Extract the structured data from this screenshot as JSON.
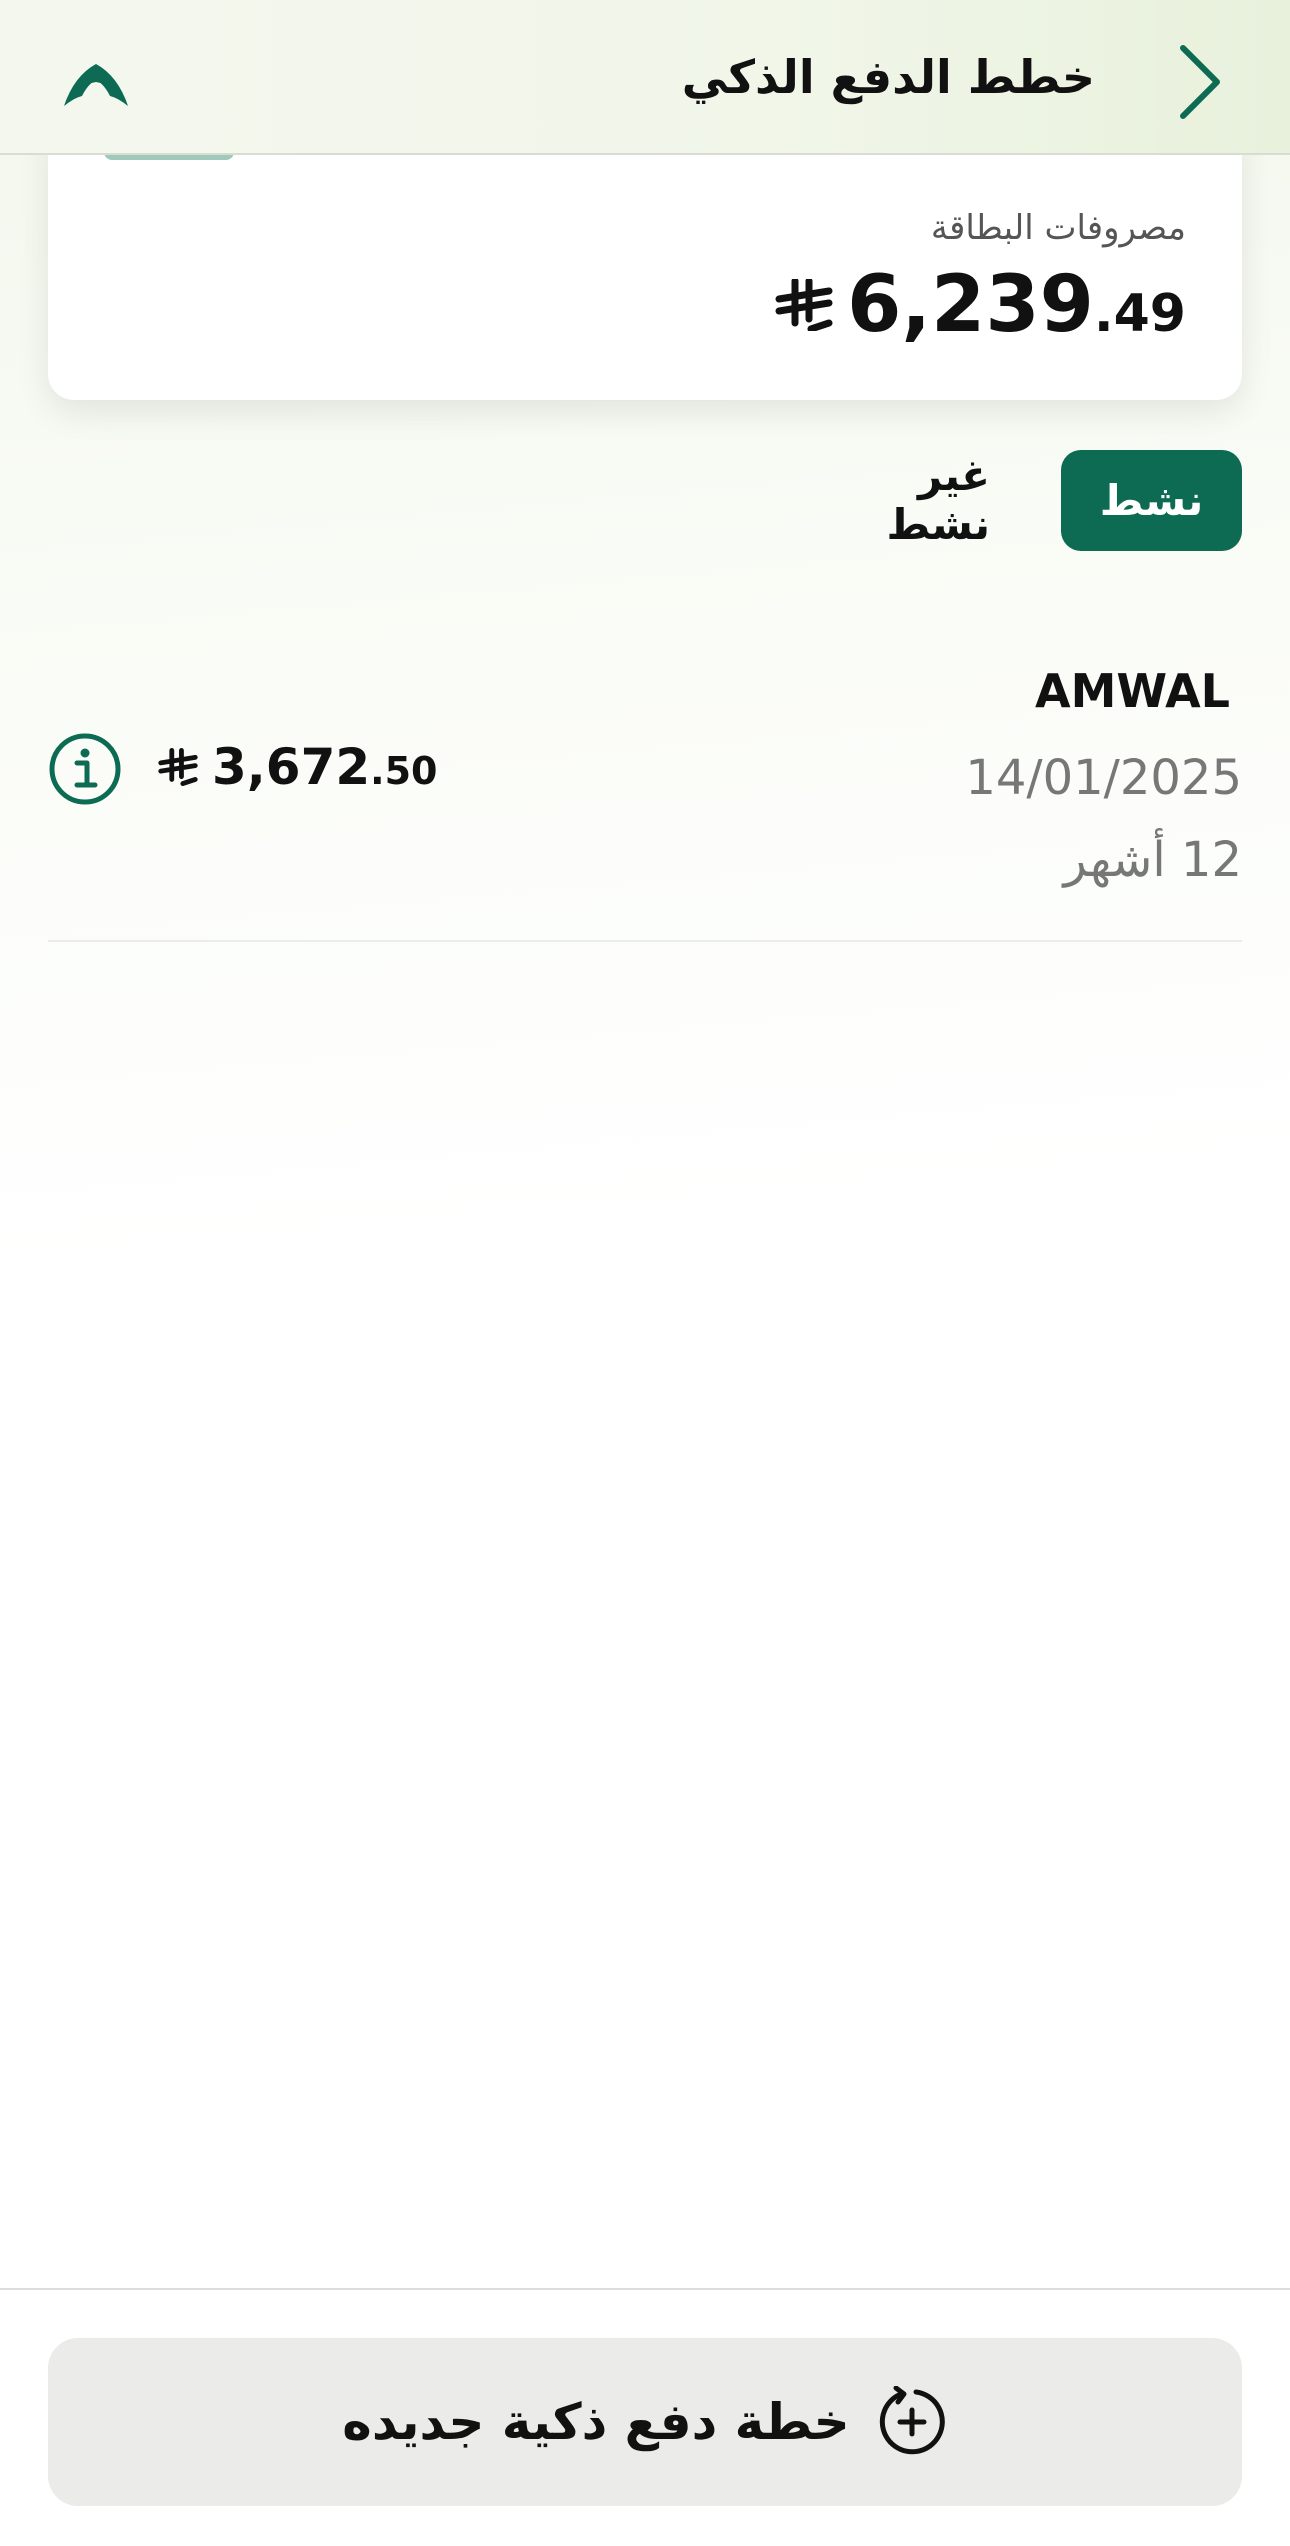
{
  "header": {
    "title": "خطط الدفع الذكي",
    "back_icon": "chevron-right-icon",
    "logo_icon": "bank-logo-icon"
  },
  "card": {
    "label": "مصروفات البطاقة",
    "amount_int": "6,239",
    "amount_dec": ".49",
    "currency_icon": "saudi-riyal-icon"
  },
  "tabs": {
    "active_label": "نشط",
    "inactive_label": "غير نشط"
  },
  "plans": [
    {
      "name": "AMWAL",
      "date": "14/01/2025",
      "duration": "12 أشهر",
      "amount_int": "3,672",
      "amount_dec": ".50"
    }
  ],
  "footer": {
    "new_plan_label": "خطة دفع ذكية جديده",
    "new_plan_icon": "add-circle-icon"
  },
  "colors": {
    "primary": "#0d6b53",
    "text": "#111111",
    "muted": "#777777",
    "button_bg": "#ebebea"
  }
}
